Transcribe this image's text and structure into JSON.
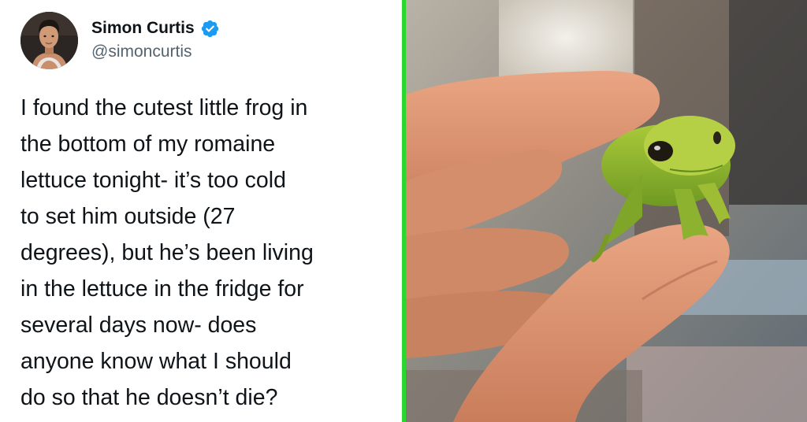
{
  "tweet": {
    "display_name": "Simon Curtis",
    "handle": "@simoncurtis",
    "verified_icon": "verified-badge-icon",
    "text_lines": [
      "I found the cutest little frog in",
      "the bottom of my romaine",
      "lettuce tonight- it’s too cold",
      "to set him outside (27",
      "degrees), but he’s been living",
      "in the lettuce in the fridge for",
      "several days now- does",
      "anyone know what I should",
      "do so that he doesn’t die?"
    ]
  },
  "colors": {
    "divider": "#2bd62f",
    "verified": "#1d9bf0",
    "name": "#0f1419",
    "handle": "#536471"
  },
  "photo": {
    "subject": "frog-on-finger-photo"
  }
}
